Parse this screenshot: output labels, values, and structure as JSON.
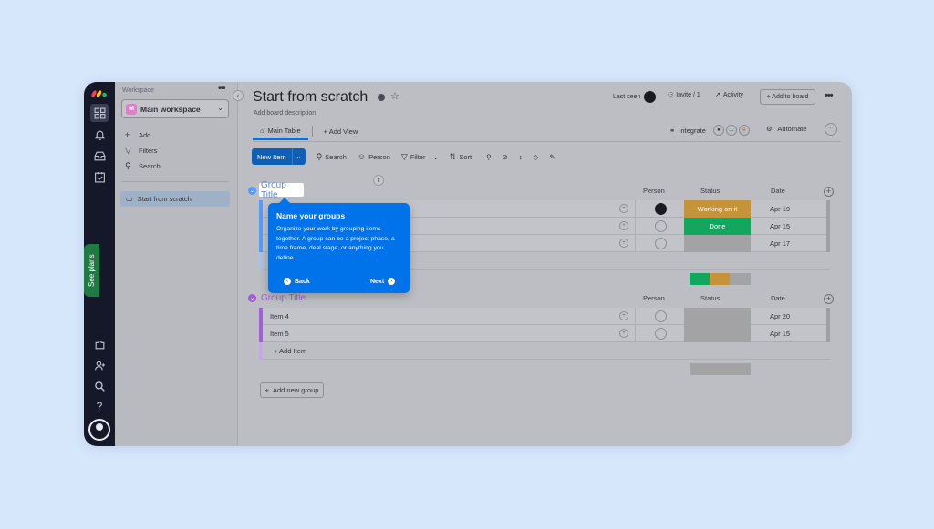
{
  "sidebar": {
    "workspace_label": "Workspace",
    "workspace_badge": "M",
    "workspace_name": "Main workspace",
    "nav": [
      {
        "label": "Add",
        "icon": "plus-icon"
      },
      {
        "label": "Filters",
        "icon": "filter-icon"
      },
      {
        "label": "Search",
        "icon": "search-icon"
      }
    ],
    "board_item": "Start from scratch"
  },
  "rail": {
    "see_plans": "See plans",
    "help": "?"
  },
  "board": {
    "title": "Start from scratch",
    "description": "Add board description",
    "last_seen": "Last seen",
    "invite": "Invite / 1",
    "activity": "Activity",
    "add_to_board": "+ Add to board",
    "tabs": [
      {
        "label": "Main Table",
        "active": true
      },
      {
        "label": "+ Add View",
        "active": false
      }
    ],
    "integrate": "Integrate",
    "automate": "Automate"
  },
  "toolbar": {
    "new_item": "New Item",
    "search": "Search",
    "person": "Person",
    "filter": "Filter",
    "sort": "Sort"
  },
  "columns": {
    "person": "Person",
    "status": "Status",
    "date": "Date"
  },
  "groups": [
    {
      "title": "Group Title",
      "color": "#579bfc",
      "rows": [
        {
          "name": "",
          "status": "Working on it",
          "status_color": "#fdab3d",
          "date": "Apr 19",
          "person_assigned": true
        },
        {
          "name": "",
          "status": "Done",
          "status_color": "#00c875",
          "date": "Apr 15",
          "person_assigned": false
        },
        {
          "name": "",
          "status": "",
          "status_color": "#c4c4c4",
          "date": "Apr 17",
          "person_assigned": false
        }
      ]
    },
    {
      "title": "Group Title",
      "color": "#a25ddc",
      "rows": [
        {
          "name": "Item 4",
          "status": "",
          "status_color": "#c4c4c4",
          "date": "Apr 20",
          "person_assigned": false
        },
        {
          "name": "Item 5",
          "status": "",
          "status_color": "#c4c4c4",
          "date": "Apr 15",
          "person_assigned": false
        }
      ],
      "add_item": "+ Add Item"
    }
  ],
  "add_new_group": "Add new group",
  "tooltip": {
    "title": "Name your groups",
    "body": "Organize your work by grouping items together. A group can be a project phase, a time frame, deal stage, or anything you define.",
    "back": "Back",
    "next": "Next"
  }
}
